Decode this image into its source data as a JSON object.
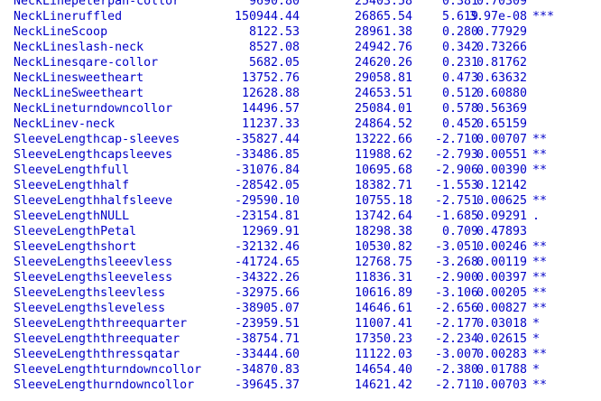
{
  "console": {
    "rows": [
      {
        "name": "NeckLinepeterpan-collor",
        "estimate": "9690.80",
        "std_error": "25403.58",
        "t_value": "0.381",
        "p_value": "0.70309",
        "signif": ""
      },
      {
        "name": "NeckLineruffled",
        "estimate": "150944.44",
        "std_error": "26865.54",
        "t_value": "5.619",
        "p_value": "3.97e-08",
        "signif": "***"
      },
      {
        "name": "NeckLineScoop",
        "estimate": "8122.53",
        "std_error": "28961.38",
        "t_value": "0.280",
        "p_value": "0.77929",
        "signif": ""
      },
      {
        "name": "NeckLineslash-neck",
        "estimate": "8527.08",
        "std_error": "24942.76",
        "t_value": "0.342",
        "p_value": "0.73266",
        "signif": ""
      },
      {
        "name": "NeckLinesqare-collor",
        "estimate": "5682.05",
        "std_error": "24620.26",
        "t_value": "0.231",
        "p_value": "0.81762",
        "signif": ""
      },
      {
        "name": "NeckLinesweetheart",
        "estimate": "13752.76",
        "std_error": "29058.81",
        "t_value": "0.473",
        "p_value": "0.63632",
        "signif": ""
      },
      {
        "name": "NeckLineSweetheart",
        "estimate": "12628.88",
        "std_error": "24653.51",
        "t_value": "0.512",
        "p_value": "0.60880",
        "signif": ""
      },
      {
        "name": "NeckLineturndowncollor",
        "estimate": "14496.57",
        "std_error": "25084.01",
        "t_value": "0.578",
        "p_value": "0.56369",
        "signif": ""
      },
      {
        "name": "NeckLinev-neck",
        "estimate": "11237.33",
        "std_error": "24864.52",
        "t_value": "0.452",
        "p_value": "0.65159",
        "signif": ""
      },
      {
        "name": "SleeveLengthcap-sleeves",
        "estimate": "-35827.44",
        "std_error": "13222.66",
        "t_value": "-2.710",
        "p_value": "0.00707",
        "signif": "**"
      },
      {
        "name": "SleeveLengthcapsleeves",
        "estimate": "-33486.85",
        "std_error": "11988.62",
        "t_value": "-2.793",
        "p_value": "0.00551",
        "signif": "**"
      },
      {
        "name": "SleeveLengthfull",
        "estimate": "-31076.84",
        "std_error": "10695.68",
        "t_value": "-2.906",
        "p_value": "0.00390",
        "signif": "**"
      },
      {
        "name": "SleeveLengthhalf",
        "estimate": "-28542.05",
        "std_error": "18382.71",
        "t_value": "-1.553",
        "p_value": "0.12142",
        "signif": ""
      },
      {
        "name": "SleeveLengthhalfsleeve",
        "estimate": "-29590.10",
        "std_error": "10755.18",
        "t_value": "-2.751",
        "p_value": "0.00625",
        "signif": "**"
      },
      {
        "name": "SleeveLengthNULL",
        "estimate": "-23154.81",
        "std_error": "13742.64",
        "t_value": "-1.685",
        "p_value": "0.09291",
        "signif": "."
      },
      {
        "name": "SleeveLengthPetal",
        "estimate": "12969.91",
        "std_error": "18298.38",
        "t_value": "0.709",
        "p_value": "0.47893",
        "signif": ""
      },
      {
        "name": "SleeveLengthshort",
        "estimate": "-32132.46",
        "std_error": "10530.82",
        "t_value": "-3.051",
        "p_value": "0.00246",
        "signif": "**"
      },
      {
        "name": "SleeveLengthsleeevless",
        "estimate": "-41724.65",
        "std_error": "12768.75",
        "t_value": "-3.268",
        "p_value": "0.00119",
        "signif": "**"
      },
      {
        "name": "SleeveLengthsleeveless",
        "estimate": "-34322.26",
        "std_error": "11836.31",
        "t_value": "-2.900",
        "p_value": "0.00397",
        "signif": "**"
      },
      {
        "name": "SleeveLengthsleevless",
        "estimate": "-32975.66",
        "std_error": "10616.89",
        "t_value": "-3.106",
        "p_value": "0.00205",
        "signif": "**"
      },
      {
        "name": "SleeveLengthsleveless",
        "estimate": "-38905.07",
        "std_error": "14646.61",
        "t_value": "-2.656",
        "p_value": "0.00827",
        "signif": "**"
      },
      {
        "name": "SleeveLengththreequarter",
        "estimate": "-23959.51",
        "std_error": "11007.41",
        "t_value": "-2.177",
        "p_value": "0.03018",
        "signif": "*"
      },
      {
        "name": "SleeveLengththreequater",
        "estimate": "-38754.71",
        "std_error": "17350.23",
        "t_value": "-2.234",
        "p_value": "0.02615",
        "signif": "*"
      },
      {
        "name": "SleeveLengththressqatar",
        "estimate": "-33444.60",
        "std_error": "11122.03",
        "t_value": "-3.007",
        "p_value": "0.00283",
        "signif": "**"
      },
      {
        "name": "SleeveLengthturndowncollor",
        "estimate": "-34870.83",
        "std_error": "14654.40",
        "t_value": "-2.380",
        "p_value": "0.01788",
        "signif": "*"
      },
      {
        "name": "SleeveLengthurndowncollor",
        "estimate": "-39645.37",
        "std_error": "14621.42",
        "t_value": "-2.711",
        "p_value": "0.00703",
        "signif": "**"
      }
    ]
  },
  "colors": {
    "text": "#0000c8",
    "background": "#ffffff"
  }
}
